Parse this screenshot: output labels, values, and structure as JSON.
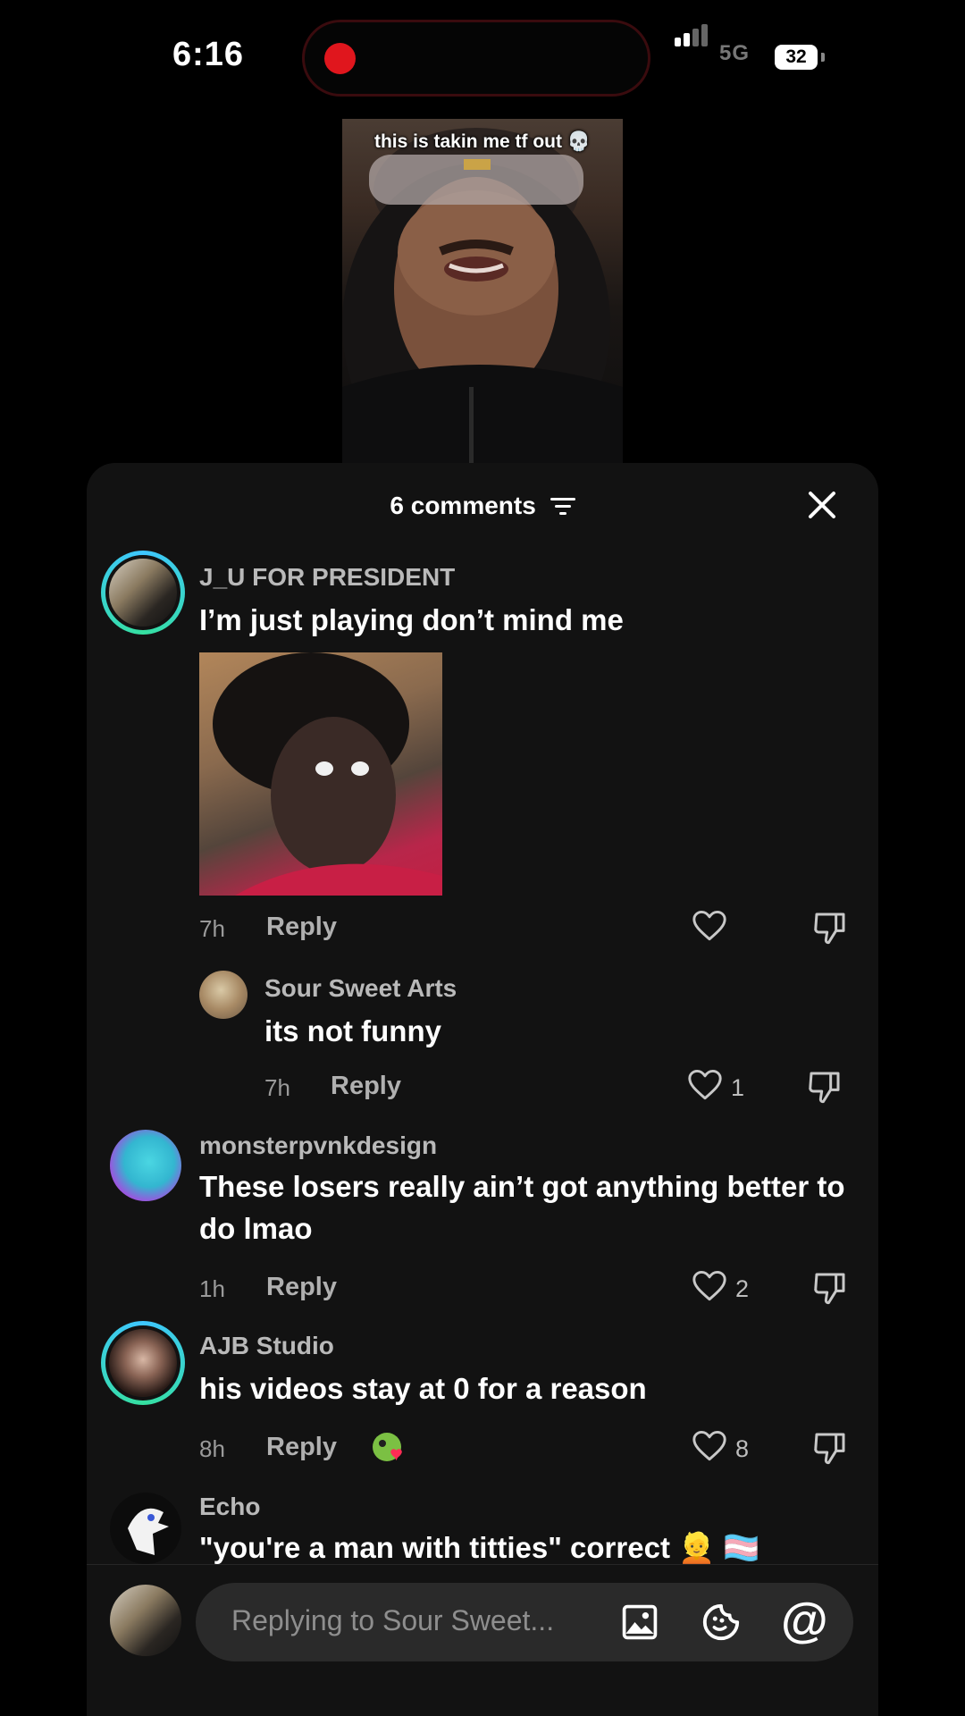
{
  "status_bar": {
    "time": "6:16",
    "network": "5G",
    "battery": "32",
    "recording_color": "#e0161d"
  },
  "video": {
    "caption": "this is takin me tf out 💀"
  },
  "comments_sheet": {
    "title": "6 comments",
    "sort_icon": "filter-lines-icon",
    "close_icon": "close-icon"
  },
  "comments": [
    {
      "username": "J_U FOR PRESIDENT",
      "text": "I’m just playing don’t mind me",
      "has_gif": true,
      "time": "7h",
      "reply_label": "Reply",
      "likes": "",
      "avatar_ring": true
    },
    {
      "username": "Sour Sweet Arts",
      "text": "its not funny",
      "time": "7h",
      "reply_label": "Reply",
      "likes": "1",
      "is_reply": true
    },
    {
      "username": "monsterpvnkdesign",
      "text": "These losers really ain’t got anything better to do lmao",
      "time": "1h",
      "reply_label": "Reply",
      "likes": "2"
    },
    {
      "username": "AJB Studio",
      "text": "his videos stay at 0 for a reason",
      "time": "8h",
      "reply_label": "Reply",
      "likes": "8",
      "avatar_ring": true,
      "creator_liked": true
    },
    {
      "username": "Echo",
      "text": "\"you're a man with titties\" correct 👱 🏳️‍⚧️"
    }
  ],
  "input": {
    "placeholder": "Replying to Sour Sweet...",
    "icons": [
      "image-icon",
      "sticker-icon",
      "mention-icon"
    ],
    "mention_label": "@"
  }
}
